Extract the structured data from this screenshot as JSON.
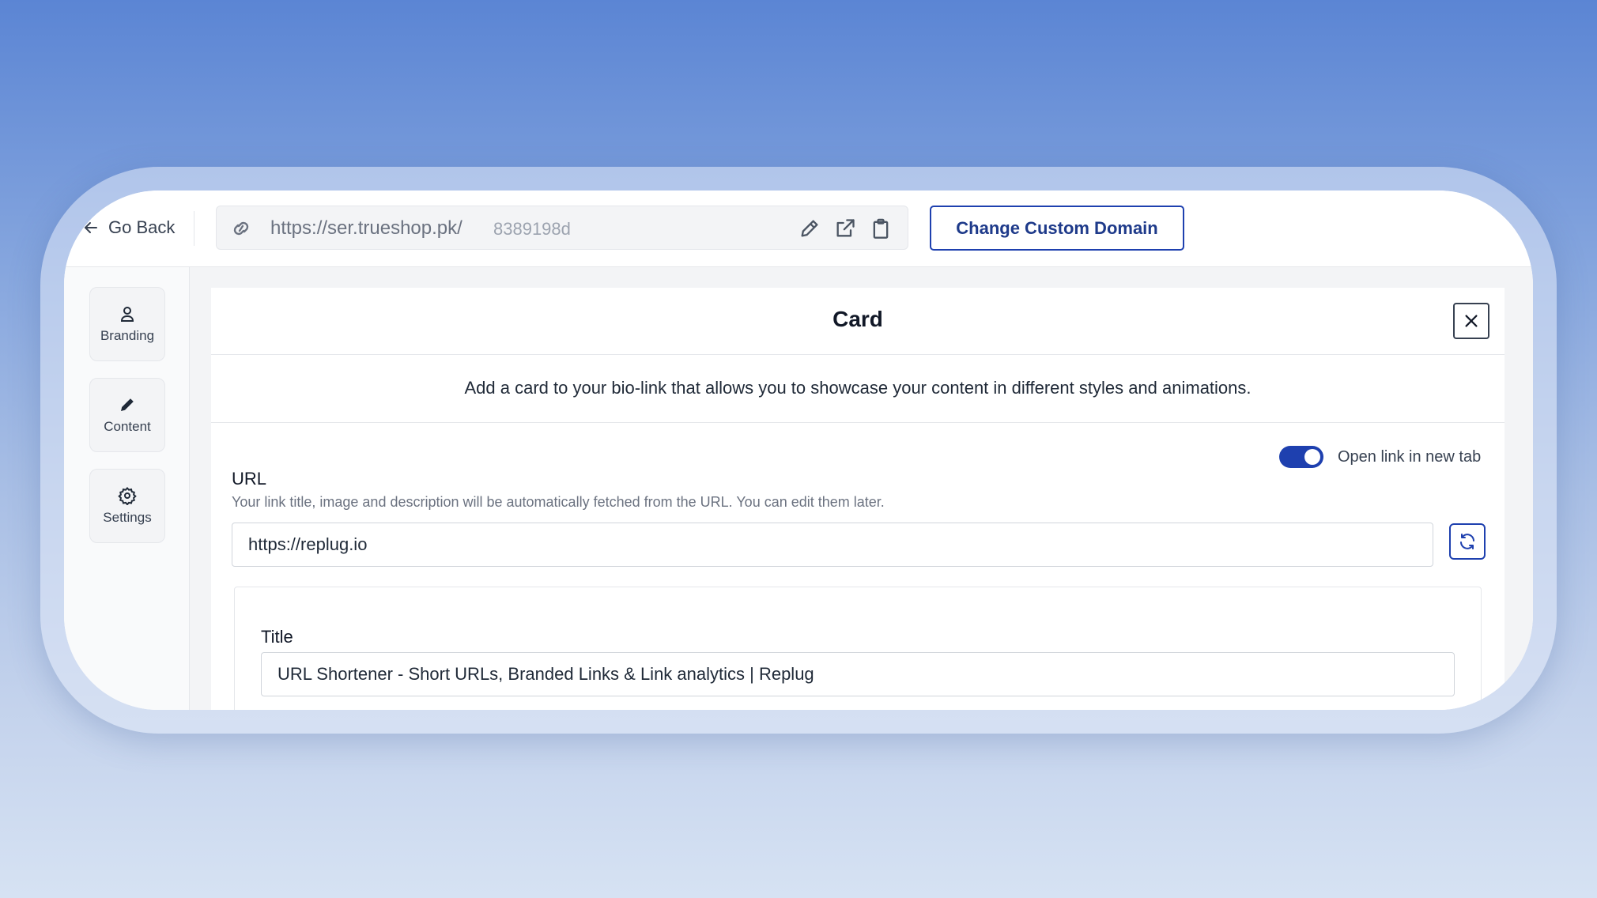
{
  "topbar": {
    "go_back_label": "Go Back",
    "url_base": "https://ser.trueshop.pk/",
    "url_slug": "8389198d",
    "change_domain_label": "Change Custom Domain"
  },
  "sidebar": {
    "items": [
      {
        "label": "Branding",
        "icon": "user-icon"
      },
      {
        "label": "Content",
        "icon": "pencil-icon"
      },
      {
        "label": "Settings",
        "icon": "gear-icon"
      }
    ]
  },
  "card_panel": {
    "title": "Card",
    "description": "Add a card to your bio-link that allows you to showcase your content in different styles and animations.",
    "open_new_tab_label": "Open link in new tab",
    "open_new_tab_enabled": true,
    "url_label": "URL",
    "url_help": "Your link title, image and description will be automatically fetched from the URL. You can edit them later.",
    "url_value": "https://replug.io",
    "title_label": "Title",
    "title_value": "URL Shortener - Short URLs, Branded Links & Link analytics | Replug"
  },
  "colors": {
    "accent": "#1e40af",
    "background_top": "#5b85d4",
    "background_bottom": "#d6e2f3"
  }
}
